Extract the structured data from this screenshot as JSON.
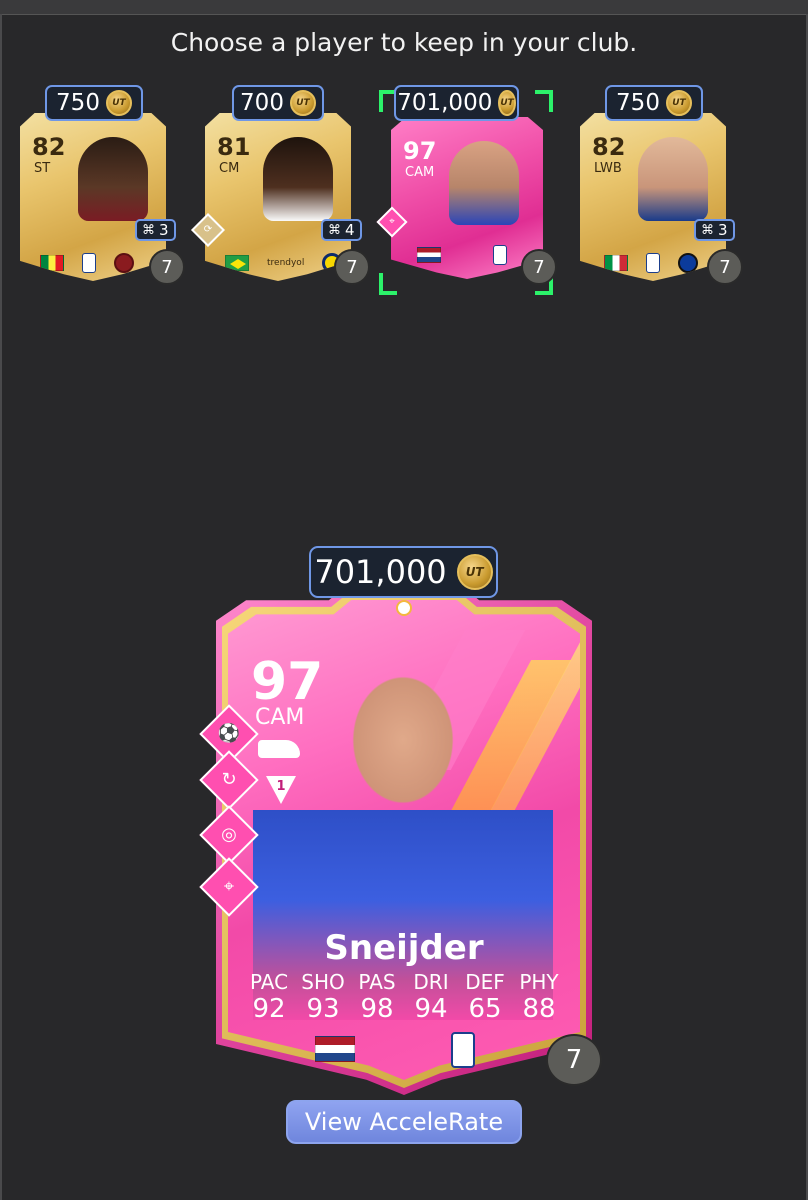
{
  "header": {
    "title": "Choose a player to keep in your club."
  },
  "coin_label": "UT",
  "cards": [
    {
      "price": "750",
      "rating": "82",
      "position": "ST",
      "chem_links": "3",
      "count": "7",
      "nation": "Senegal",
      "selected": false
    },
    {
      "price": "700",
      "rating": "81",
      "position": "CM",
      "chem_links": "4",
      "count": "7",
      "nation": "Brazil",
      "club_text": "trendyol",
      "selected": false
    },
    {
      "price": "701,000",
      "rating": "97",
      "position": "CAM",
      "count": "7",
      "nation": "Netherlands",
      "selected": true
    },
    {
      "price": "750",
      "rating": "82",
      "position": "LWB",
      "chem_links": "3",
      "count": "7",
      "nation": "Italy",
      "selected": false
    }
  ],
  "detail": {
    "price": "701,000",
    "rating": "97",
    "position": "CAM",
    "weak_foot": "1",
    "name": "Sneijder",
    "stats": [
      {
        "label": "PAC",
        "value": "92"
      },
      {
        "label": "SHO",
        "value": "93"
      },
      {
        "label": "PAS",
        "value": "98"
      },
      {
        "label": "DRI",
        "value": "94"
      },
      {
        "label": "DEF",
        "value": "65"
      },
      {
        "label": "PHY",
        "value": "88"
      }
    ],
    "count": "7",
    "playstyles": [
      "playmaker-icon",
      "dribble-icon",
      "ball-control-icon",
      "location-icon"
    ]
  },
  "button": {
    "label": "View AcceleRate"
  },
  "colors": {
    "background": "#28282a",
    "accent": "#6f97e6",
    "select": "#2cf26a",
    "pink": "#f24aa8"
  }
}
